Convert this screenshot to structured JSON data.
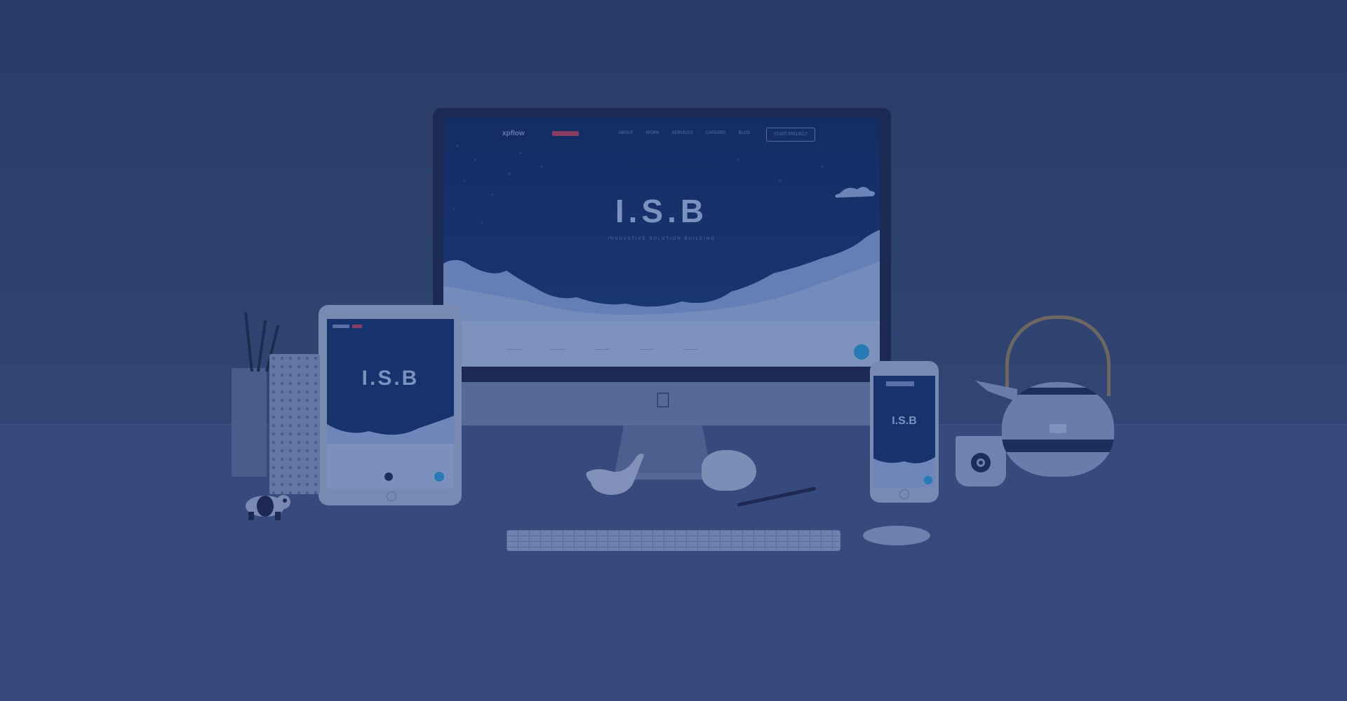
{
  "scene": {
    "colors": {
      "background": "#32436d",
      "desk": "#3f5283",
      "screen": "#112e66",
      "accent_red": "#b2405f",
      "accent_blue": "#2a96d0"
    }
  },
  "imac": {
    "site_logo": "xpflow",
    "nav": [
      "ABOUT",
      "WORK",
      "SERVICES",
      "CAREERS",
      "BLOG"
    ],
    "cta": "START PROJECT",
    "hero_title": "I.S.B",
    "hero_subtitle": "INNOVATIVE SOLUTION BUILDING",
    "footer_items": [
      "———",
      "———",
      "———",
      "———",
      "———"
    ]
  },
  "ipad": {
    "hero_title": "I.S.B"
  },
  "iphone": {
    "hero_title": "I.S.B"
  },
  "icons": [
    "apple-logo-icon",
    "chat-bubble-icon"
  ]
}
